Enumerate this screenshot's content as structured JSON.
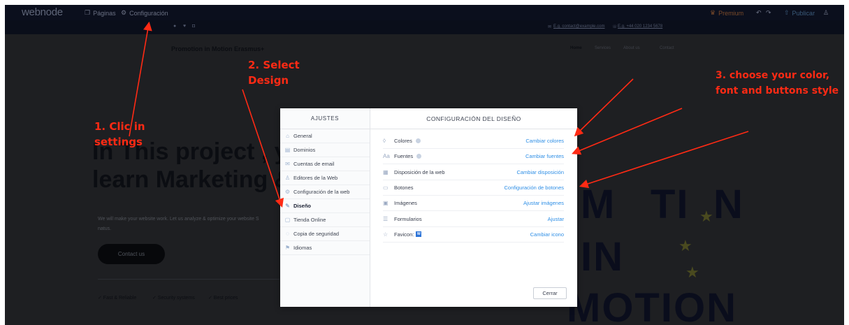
{
  "editor_bar": {
    "logo": "webnode",
    "paginas": "Páginas",
    "configuracion": "Configuración",
    "premium": "Premium",
    "publicar": "Publicar"
  },
  "contact_bar": {
    "email": "E.g. contact@example.com",
    "phone": "E.g. +44 020 1234 5678"
  },
  "site": {
    "brand": "Promotion in Motion Erasmus+",
    "nav": [
      "Home",
      "Services",
      "About us",
      "Contact"
    ],
    "hero_line1": "In This project , y",
    "hero_line2": "learn Marketing &",
    "desc": "We will make your website work. Let us analyze & optimize your website S",
    "desc2": "natus.",
    "contact_button": "Contact us",
    "features": [
      "✓ Fast & Reliable",
      "✓ Security systems",
      "✓ Best prices"
    ],
    "image_words": [
      "M",
      "TI",
      "N",
      "IN",
      "MOTION"
    ]
  },
  "modal": {
    "sidebar_title": "AJUSTES",
    "sidebar_items": [
      {
        "label": "General",
        "icon": "home-icon"
      },
      {
        "label": "Dominios",
        "icon": "domain-icon"
      },
      {
        "label": "Cuentas de email",
        "icon": "mail-icon"
      },
      {
        "label": "Editores de la Web",
        "icon": "user-icon"
      },
      {
        "label": "Configuración de la web",
        "icon": "gear-icon"
      },
      {
        "label": "Diseño",
        "icon": "brush-icon"
      },
      {
        "label": "Tienda Online",
        "icon": "bag-icon"
      },
      {
        "label": "Copia de seguridad",
        "icon": "backup-icon"
      },
      {
        "label": "Idiomas",
        "icon": "flag-icon"
      }
    ],
    "main_title": "CONFIGURACIÓN DEL DISEÑO",
    "rows": [
      {
        "label": "Colores",
        "link": "Cambiar colores",
        "icon": "drop-icon"
      },
      {
        "label": "Fuentes",
        "link": "Cambiar fuentes",
        "icon": "font-icon"
      },
      {
        "label": "Disposición de la web",
        "link": "Cambiar disposición",
        "icon": "layout-icon"
      },
      {
        "label": "Botones",
        "link": "Configuración de botones",
        "icon": "button-icon"
      },
      {
        "label": "Imágenes",
        "link": "Ajustar imágenes",
        "icon": "image-icon"
      },
      {
        "label": "Formularios",
        "link": "Ajustar",
        "icon": "form-icon"
      },
      {
        "label": "Favicon:",
        "link": "Cambiar icono",
        "icon": "star-icon"
      }
    ],
    "close_button": "Cerrar",
    "favicon_badge": "W",
    "fuentes_icon_text": "Aa"
  },
  "annotations": {
    "step1_line1": "1. Clic in",
    "step1_line2": "settings",
    "step2_line1": "2. Select",
    "step2_line2": "Design",
    "step3_line1": "3. choose your color,",
    "step3_line2": "font and buttons style"
  },
  "colors": {
    "annotation_red": "#ff2a14",
    "link_blue": "#2f8fe6",
    "editor_bar": "#0b0f1d",
    "dim_overlay": "#1e1f22"
  }
}
